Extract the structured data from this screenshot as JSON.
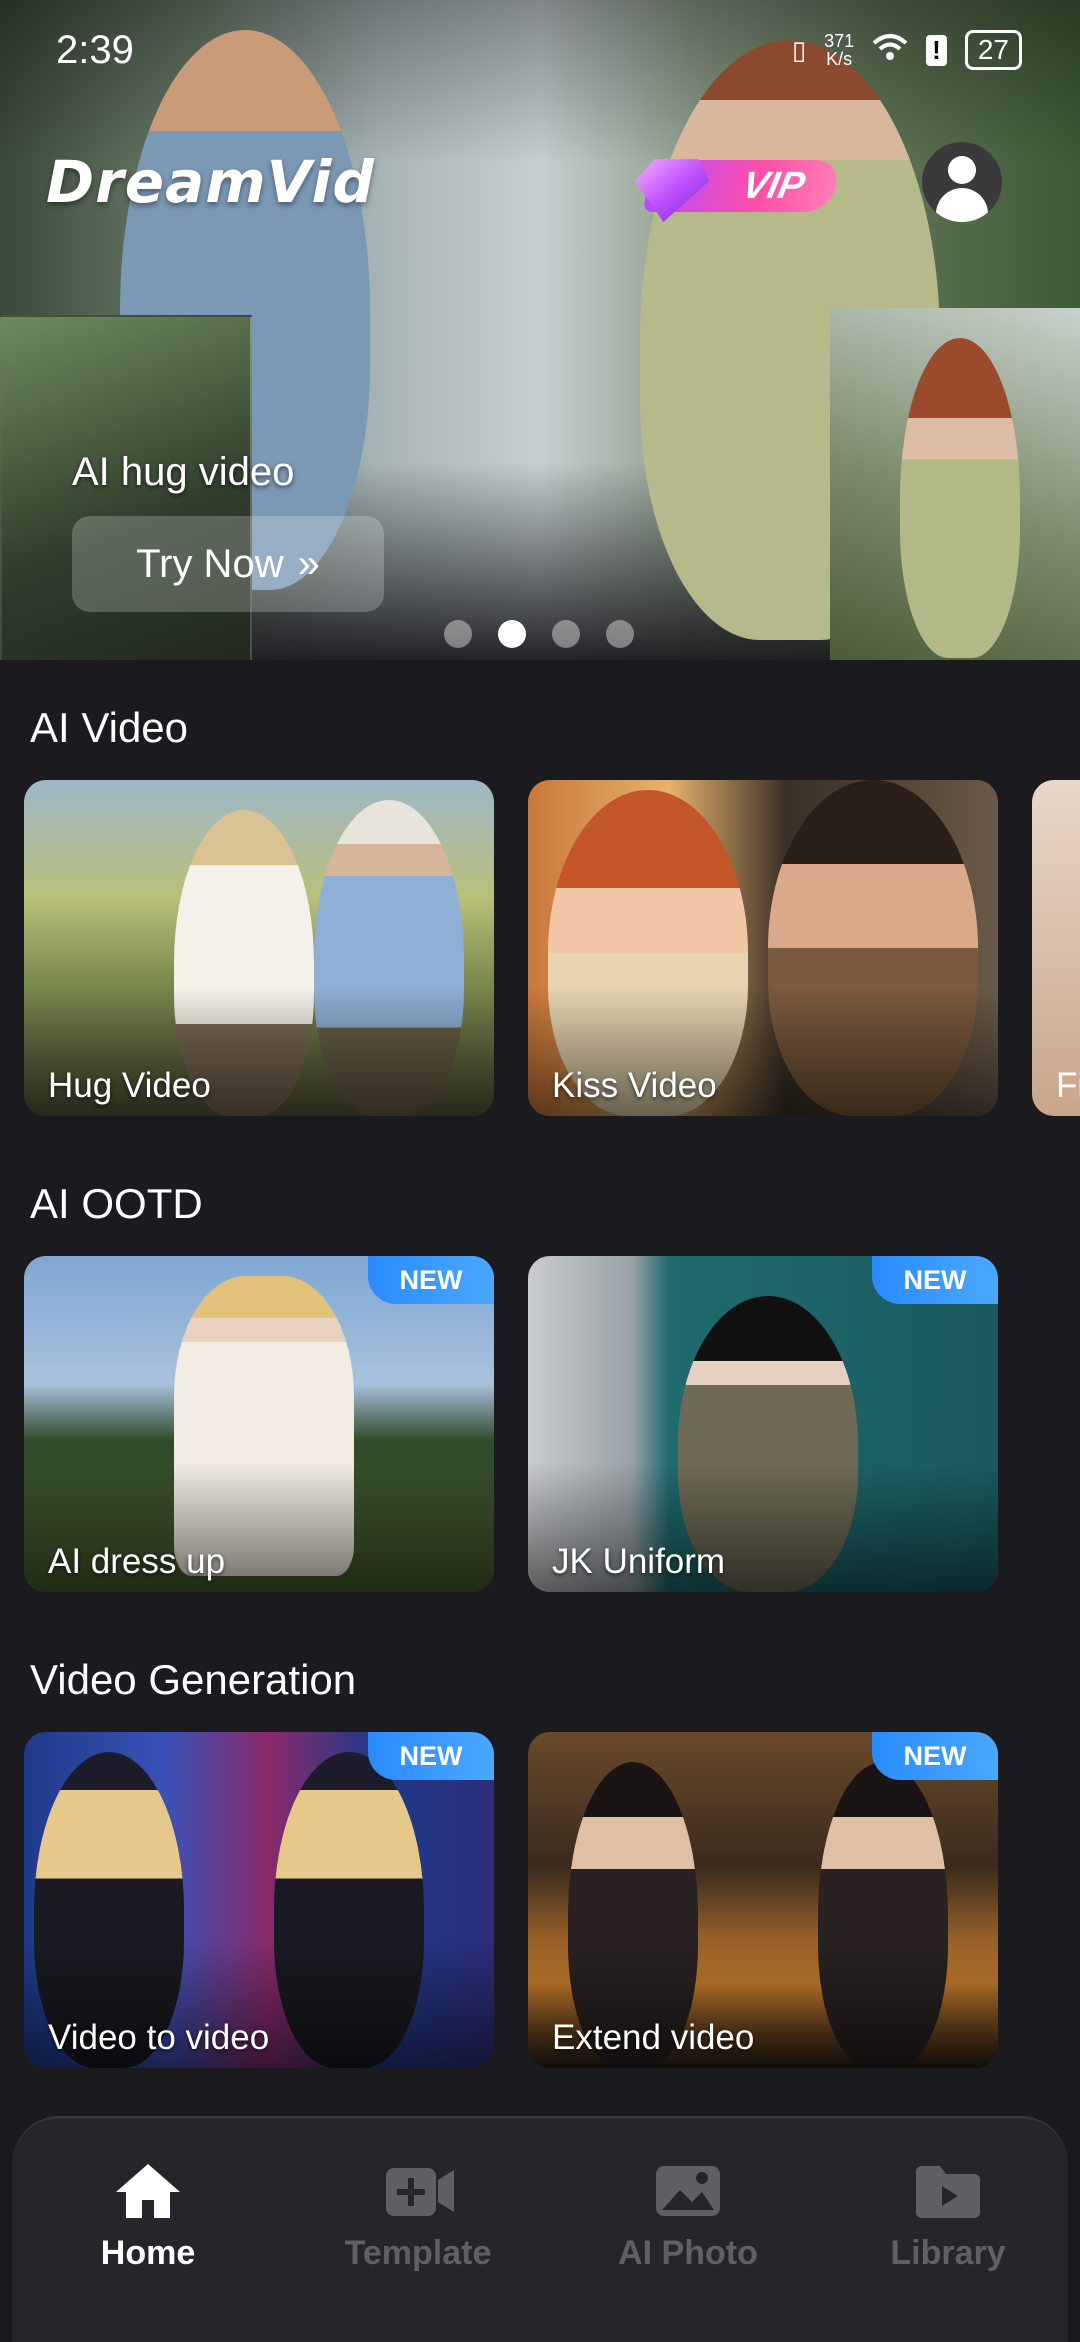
{
  "status_bar": {
    "time": "2:39",
    "net_speed_top": "371",
    "net_speed_unit": "K/s",
    "battery": "27"
  },
  "header": {
    "logo": "DreamVid",
    "vip_label": "VIP"
  },
  "hero": {
    "title": "AI hug video",
    "cta": "Try Now",
    "cta_icon": "»",
    "active_slide": 2,
    "slide_count": 4
  },
  "sections": [
    {
      "title": "AI Video",
      "cards": [
        {
          "label": "Hug Video",
          "new": false
        },
        {
          "label": "Kiss Video",
          "new": false
        }
      ],
      "peek_label": "Fi"
    },
    {
      "title": "AI OOTD",
      "cards": [
        {
          "label": "AI dress up",
          "new": true
        },
        {
          "label": "JK Uniform",
          "new": true
        }
      ]
    },
    {
      "title": "Video Generation",
      "cards": [
        {
          "label": "Video to video",
          "new": true
        },
        {
          "label": "Extend video",
          "new": true
        }
      ]
    }
  ],
  "badge_text": "NEW",
  "bottom_nav": [
    {
      "label": "Home",
      "icon": "home-icon",
      "active": true
    },
    {
      "label": "Template",
      "icon": "template-icon",
      "active": false
    },
    {
      "label": "AI Photo",
      "icon": "ai-photo-icon",
      "active": false
    },
    {
      "label": "Library",
      "icon": "library-icon",
      "active": false
    }
  ],
  "colors": {
    "background": "#1b1b1f",
    "badge": "#2a8bff",
    "vip_start": "#b44bff",
    "vip_end": "#ff4fa8",
    "nav_inactive": "#5f5f66"
  }
}
